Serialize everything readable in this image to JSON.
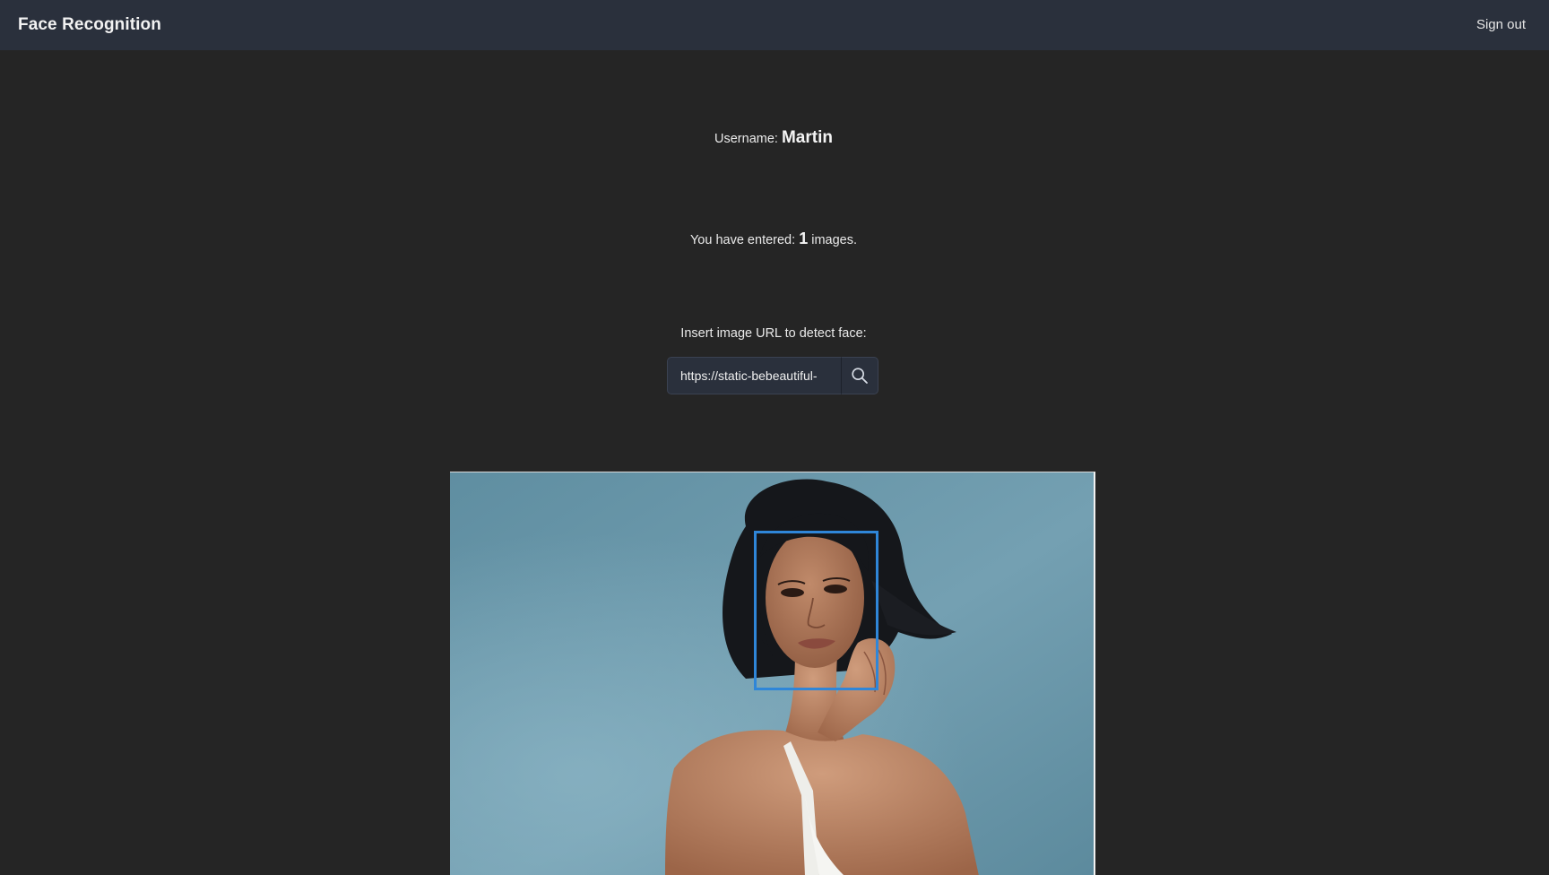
{
  "navbar": {
    "brand": "Face Recognition",
    "signout_label": "Sign out"
  },
  "profile": {
    "username_label": "Username:",
    "username": "Martin"
  },
  "stats": {
    "prefix": "You have entered:",
    "count": "1",
    "suffix": "images."
  },
  "detect": {
    "prompt": "Insert image URL to detect face:",
    "url_value": "https://static-bebeautiful-",
    "search_icon": "search-icon"
  },
  "result": {
    "image_subject": "portrait-photo",
    "face_box_color": "#2f86d8"
  },
  "colors": {
    "background": "#252525",
    "navbar": "#2a303c",
    "accent": "#2f86d8"
  }
}
